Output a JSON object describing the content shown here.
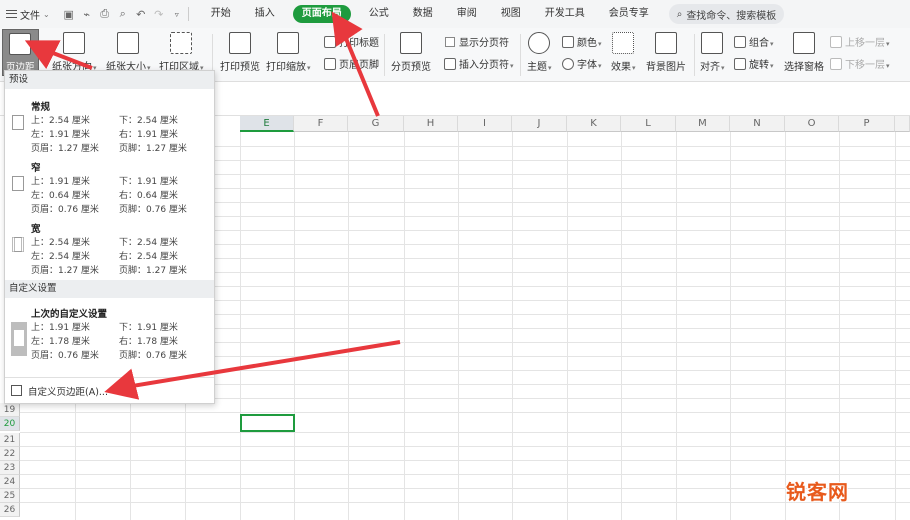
{
  "menubar": {
    "file_label": "文件",
    "tabs": [
      {
        "label": "开始"
      },
      {
        "label": "插入"
      },
      {
        "label": "页面布局",
        "active": true
      },
      {
        "label": "公式"
      },
      {
        "label": "数据"
      },
      {
        "label": "审阅"
      },
      {
        "label": "视图"
      },
      {
        "label": "开发工具"
      },
      {
        "label": "会员专享"
      }
    ],
    "search_placeholder": "查找命令、搜索模板"
  },
  "ribbon": {
    "margins": "页边距",
    "orientation": "纸张方向",
    "size": "纸张大小",
    "print_area": "打印区域",
    "print_preview": "打印预览",
    "print_scale": "打印缩放",
    "print_titles": "打印标题",
    "header_footer": "页眉页脚",
    "page_break_preview": "分页预览",
    "show_page_breaks": "显示分页符",
    "insert_page_break": "插入分页符",
    "themes": "主题",
    "colors": "颜色",
    "fonts": "字体",
    "effects": "效果",
    "background": "背景图片",
    "align": "对齐",
    "group": "组合",
    "rotate": "旋转",
    "selection_pane": "选择窗格",
    "bring_forward": "上移一层",
    "send_backward": "下移一层"
  },
  "sheet": {
    "columns": [
      "E",
      "F",
      "G",
      "H",
      "I",
      "J",
      "K",
      "L",
      "M",
      "N",
      "O",
      "P"
    ],
    "selected_column": "E",
    "rows": [
      "19",
      "20",
      "21",
      "22",
      "23",
      "24",
      "25",
      "26"
    ],
    "selected_row": "20"
  },
  "margin_panel": {
    "presets_header": "预设",
    "presets": [
      {
        "name": "常规",
        "top": "上：2.54 厘米",
        "bottom": "下：2.54 厘米",
        "left": "左：1.91 厘米",
        "right": "右：1.91 厘米",
        "header": "页眉：1.27 厘米",
        "footer": "页脚：1.27 厘米"
      },
      {
        "name": "窄",
        "top": "上：1.91 厘米",
        "bottom": "下：1.91 厘米",
        "left": "左：0.64 厘米",
        "right": "右：0.64 厘米",
        "header": "页眉：0.76 厘米",
        "footer": "页脚：0.76 厘米"
      },
      {
        "name": "宽",
        "top": "上：2.54 厘米",
        "bottom": "下：2.54 厘米",
        "left": "左：2.54 厘米",
        "right": "右：2.54 厘米",
        "header": "页眉：1.27 厘米",
        "footer": "页脚：1.27 厘米"
      }
    ],
    "custom_header": "自定义设置",
    "last_custom": {
      "name": "上次的自定义设置",
      "top": "上：1.91 厘米",
      "bottom": "下：1.91 厘米",
      "left": "左：1.78 厘米",
      "right": "右：1.78 厘米",
      "header": "页眉：0.76 厘米",
      "footer": "页脚：0.76 厘米"
    },
    "custom_margins_action": "自定义页边距(A)..."
  },
  "watermark": "锐客网",
  "colors": {
    "accent": "#1e9b3e",
    "arrow": "#e8383d",
    "watermark": "#e85a1c"
  }
}
